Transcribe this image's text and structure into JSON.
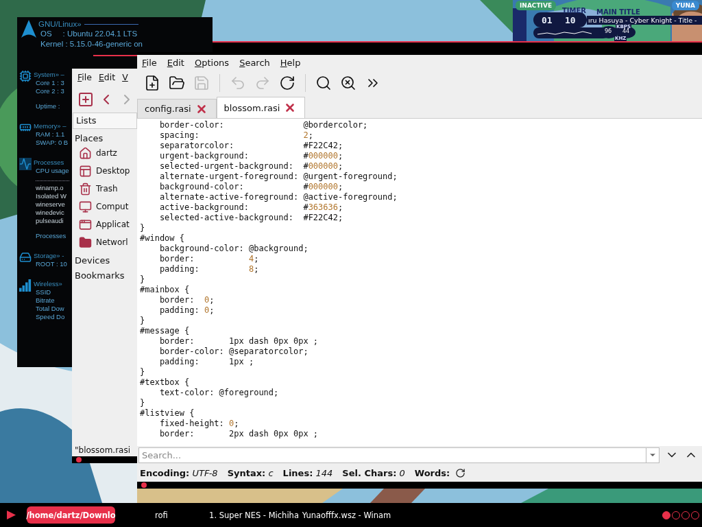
{
  "conky": {
    "sections": [
      {
        "kind": "os",
        "title": "GNU/Linux»",
        "lines": [
          "OS     : Ubuntu 22.04.1 LTS",
          "Kernel : 5.15.0-46-generic on"
        ]
      },
      {
        "kind": "cpu",
        "title": "System» –",
        "lines": [
          "Core 1 : 3",
          "Core 2 : 3"
        ],
        "footer": "Uptime :"
      },
      {
        "kind": "memory",
        "title": "Memory» –",
        "lines": [
          "RAM : 1.1",
          "SWAP: 0 B"
        ]
      },
      {
        "kind": "processes",
        "title": "Processes",
        "lines": [
          "CPU usage"
        ],
        "items": [
          "winamp.o",
          "Isolated W",
          "wineserve",
          "winedevic",
          "pulseaudi"
        ],
        "footer": "Processes"
      },
      {
        "kind": "storage",
        "title": "Storage» -",
        "lines": [
          "ROOT : 10"
        ]
      },
      {
        "kind": "wireless",
        "title": "Wireless»",
        "lines": [
          "SSID",
          "Bitrate",
          "Total Dow",
          "Speed Do"
        ]
      }
    ]
  },
  "winamp": {
    "status": "INACTIVE",
    "timer_label": "TIMER",
    "minutes": "01",
    "seconds": "10",
    "title_label": "MAIN TITLE",
    "title": "ıru Hasuya - Cyber Knight - Title -",
    "kbps": "96",
    "kbps_label": "KBPS",
    "khz": "44",
    "khz_label": "KHZ",
    "skin": "YUNA"
  },
  "file_manager": {
    "menu": [
      "File",
      "Edit",
      "V"
    ],
    "toolbar": [
      {
        "kind": "new-tab",
        "disabled": false
      },
      {
        "kind": "back",
        "disabled": false
      },
      {
        "kind": "forward",
        "disabled": true
      }
    ],
    "view": "Lists",
    "sections": [
      {
        "title": "Places",
        "items": [
          {
            "label": "dartz",
            "kind": "home"
          },
          {
            "label": "Desktop",
            "kind": "desktop"
          },
          {
            "label": "Trash",
            "kind": "trash"
          },
          {
            "label": "Comput",
            "kind": "computer"
          },
          {
            "label": "Applicat",
            "kind": "applications"
          },
          {
            "label": "Networl",
            "kind": "network"
          }
        ]
      },
      {
        "title": "Devices"
      },
      {
        "title": "Bookmarks"
      }
    ],
    "status": "\"blossom.rasi"
  },
  "editor": {
    "menu": [
      "File",
      "Edit",
      "Options",
      "Search",
      "Help"
    ],
    "toolbar": [
      {
        "kind": "new",
        "disabled": false
      },
      {
        "kind": "open",
        "disabled": false
      },
      {
        "kind": "save",
        "disabled": true
      },
      {
        "kind": "undo",
        "disabled": true
      },
      {
        "kind": "redo",
        "disabled": true
      },
      {
        "kind": "reload",
        "disabled": false
      },
      {
        "kind": "find",
        "disabled": false
      },
      {
        "kind": "replace",
        "disabled": false
      },
      {
        "kind": "more",
        "disabled": false
      }
    ],
    "tabs": [
      {
        "label": "config.rasi",
        "selected": false
      },
      {
        "label": "blossom.rasi",
        "selected": true
      }
    ],
    "code": [
      {
        "text": "    border-color:                @bordercolor;"
      },
      {
        "text": "    spacing:                     ",
        "value": "2",
        "after": ";"
      },
      {
        "text": "    separatorcolor:              #F22C42;"
      },
      {
        "text": "    urgent-background:           #",
        "value": "000000",
        "after": ";"
      },
      {
        "text": "    selected-urgent-background:  #",
        "value": "000000",
        "after": ";"
      },
      {
        "text": "    alternate-urgent-foreground: @urgent-foreground;"
      },
      {
        "text": "    background-color:            #",
        "value": "000000",
        "after": ";"
      },
      {
        "text": "    alternate-active-foreground: @active-foreground;"
      },
      {
        "text": "    active-background:           #",
        "value": "363636",
        "after": ";"
      },
      {
        "text": "    selected-active-background:  #F22C42;"
      },
      {
        "text": "}"
      },
      {
        "text": "#window {"
      },
      {
        "text": "    background-color: @background;"
      },
      {
        "text": "    border:           ",
        "value": "4",
        "after": ";"
      },
      {
        "text": "    padding:          ",
        "value": "8",
        "after": ";"
      },
      {
        "text": "}"
      },
      {
        "text": "#mainbox {"
      },
      {
        "text": "    border:  ",
        "value": "0",
        "after": ";"
      },
      {
        "text": "    padding: ",
        "value": "0",
        "after": ";"
      },
      {
        "text": "}"
      },
      {
        "text": "#message {"
      },
      {
        "text": "    border:       1px dash 0px 0px ;"
      },
      {
        "text": "    border-color: @separatorcolor;"
      },
      {
        "text": "    padding:      1px ;"
      },
      {
        "text": "}"
      },
      {
        "text": "#textbox {"
      },
      {
        "text": "    text-color: @foreground;"
      },
      {
        "text": "}"
      },
      {
        "text": "#listview {"
      },
      {
        "text": "    fixed-height: ",
        "value": "0",
        "after": ";"
      },
      {
        "text": "    border:       2px dash 0px 0px ;"
      }
    ],
    "search": {
      "placeholder": "Search..."
    },
    "status": [
      {
        "label": "Encoding:",
        "value": "UTF-8"
      },
      {
        "label": "Syntax:",
        "value": "c"
      },
      {
        "label": "Lines:",
        "value": "144"
      },
      {
        "label": "Sel. Chars:",
        "value": "0"
      },
      {
        "label": "Words:"
      }
    ]
  },
  "taskbar": {
    "tasks": [
      {
        "label": "/home/dartz/Downlo",
        "selected": true
      },
      {
        "label": "rofi",
        "selected": false
      },
      {
        "label": "1. Super NES - Michiha",
        "selected": false
      },
      {
        "label": "Yunaofffx.wsz - Winam",
        "selected": false
      }
    ],
    "workspaces": [
      {
        "selected": true
      },
      {
        "selected": false
      },
      {
        "selected": false
      },
      {
        "selected": false
      }
    ]
  }
}
